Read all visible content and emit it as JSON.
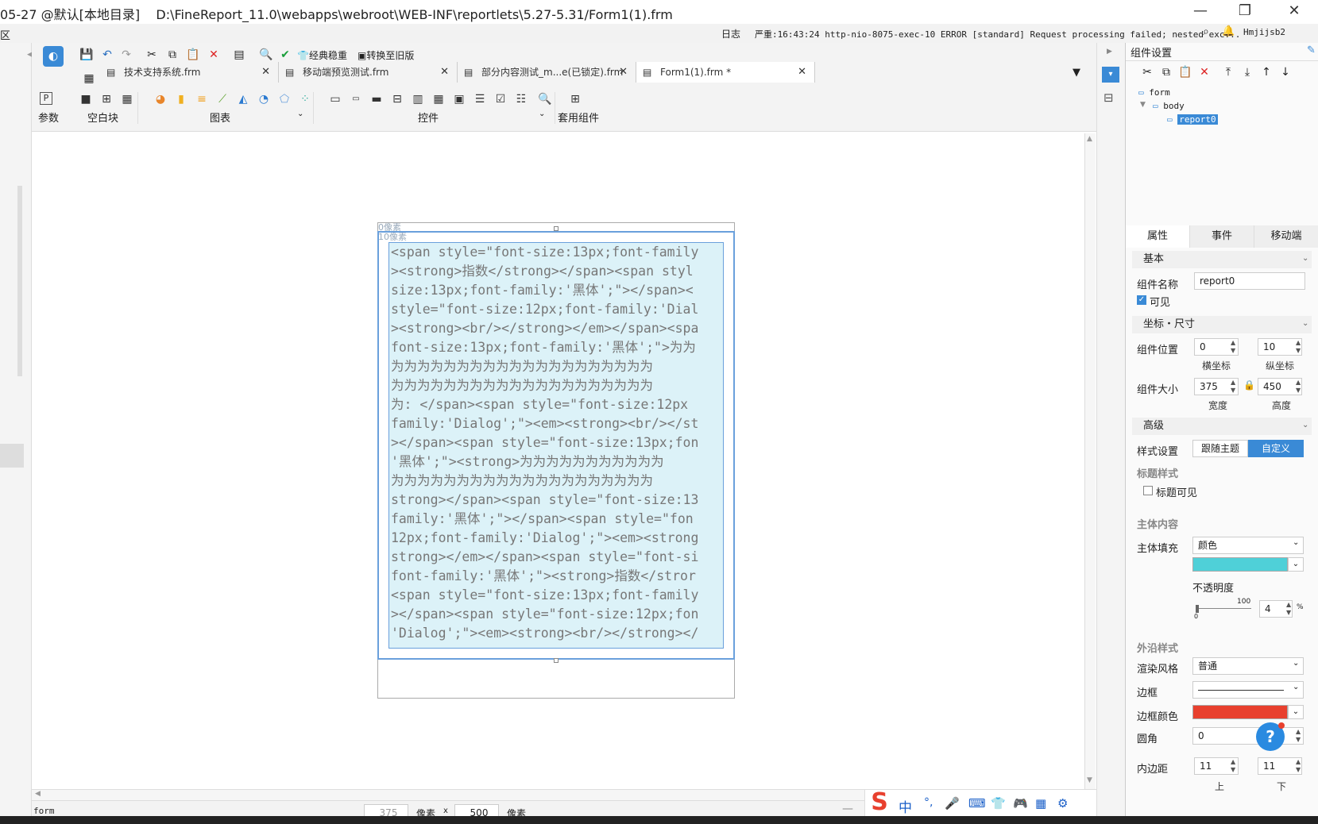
{
  "titlebar": {
    "title": "05-27 @默认[本地目录]    D:\\FineReport_11.0\\webapps\\webroot\\WEB-INF\\reportlets\\5.27-5.31/Form1(1).frm",
    "minimize": "—",
    "maximize": "❐",
    "close": "✕"
  },
  "logbar": {
    "log_label": "日志",
    "message": "严重:16:43:24 http-nio-8075-exec-10 ERROR [standard] Request processing failed; nested exc...",
    "user": "Hmjijsb2",
    "left_label": "区"
  },
  "toolbar": {
    "classic_label": "经典稳重",
    "convert_label": "转换至旧版",
    "tabs": [
      {
        "label": "技术支持系统.frm"
      },
      {
        "label": "移动端预览测试.frm"
      },
      {
        "label": "部分内容测试_m...e(已锁定).frm"
      },
      {
        "label": "Form1(1).frm *"
      }
    ],
    "groups": {
      "param": "参数",
      "blank": "空白块",
      "chart": "图表",
      "control": "控件",
      "suite": "套用组件"
    }
  },
  "canvas": {
    "top_label": "0像素",
    "inner_label": "10像素",
    "report_lines": [
      "<span style=\"font-size:13px;font-family",
      "><strong>指数</strong></span><span styl",
      "size:13px;font-family:'黑体';\"></span><",
      "style=\"font-size:12px;font-family:'Dial",
      "><strong><br/></strong></em></span><spa",
      "font-size:13px;font-family:'黑体';\">为为",
      "为为为为为为为为为为为为为为为为为为为为",
      "为为为为为为为为为为为为为为为为为为为为",
      "为: </span><span style=\"font-size:12px",
      "family:'Dialog';\"><em><strong><br/></st",
      "></span><span style=\"font-size:13px;fon",
      "'黑体';\"><strong>为为为为为为为为为为为",
      "为为为为为为为为为为为为为为为为为为为为",
      "strong></span><span style=\"font-size:13",
      "family:'黑体';\"></span><span style=\"fon",
      "12px;font-family:'Dialog';\"><em><strong",
      "strong></em></span><span style=\"font-si",
      "font-family:'黑体';\"><strong>指数</stror",
      "<span style=\"font-size:13px;font-family",
      "></span><span style=\"font-size:12px;fon",
      "'Dialog';\"><em><strong><br/></strong></"
    ]
  },
  "statusbar": {
    "form_label": "form",
    "width_value": "375",
    "unit1": "像素",
    "times": "x",
    "height_value": "500",
    "unit2": "像素",
    "ime": [
      "中",
      "°,",
      "🎤",
      "⌨",
      "👕",
      "🎮",
      "▦",
      "⚙"
    ]
  },
  "panel": {
    "title": "组件设置",
    "tree": {
      "form": "form",
      "body": "body",
      "report": "report0"
    },
    "tabs": [
      "属性",
      "事件",
      "移动端"
    ],
    "basic_section": "基本",
    "name_label": "组件名称",
    "name_value": "report0",
    "visible_label": "可见",
    "coord_section": "坐标・尺寸",
    "pos_label": "组件位置",
    "pos_x": "0",
    "pos_y": "10",
    "x_label": "横坐标",
    "y_label": "纵坐标",
    "size_label": "组件大小",
    "width": "375",
    "height": "450",
    "w_label": "宽度",
    "h_label": "高度",
    "adv_section": "高级",
    "style_label": "样式设置",
    "style_follow": "跟随主题",
    "style_custom": "自定义",
    "title_style": "标题样式",
    "title_visible": "标题可见",
    "body_content": "主体内容",
    "fill_label": "主体填充",
    "fill_type": "颜色",
    "fill_color": "#4fd0d8",
    "opacity_label": "不透明度",
    "slider_min": "0",
    "slider_max": "100",
    "opacity_value": "4",
    "percent": "%",
    "outer_style": "外沿样式",
    "render_label": "渲染风格",
    "render_value": "普通",
    "border_label": "边框",
    "border_color_label": "边框颜色",
    "border_color": "#e8402e",
    "radius_label": "圆角",
    "radius_value": "0",
    "padding_label": "内边距",
    "pad_top": "11",
    "pad_bottom": "11",
    "top_label": "上",
    "bottom_label": "下"
  }
}
